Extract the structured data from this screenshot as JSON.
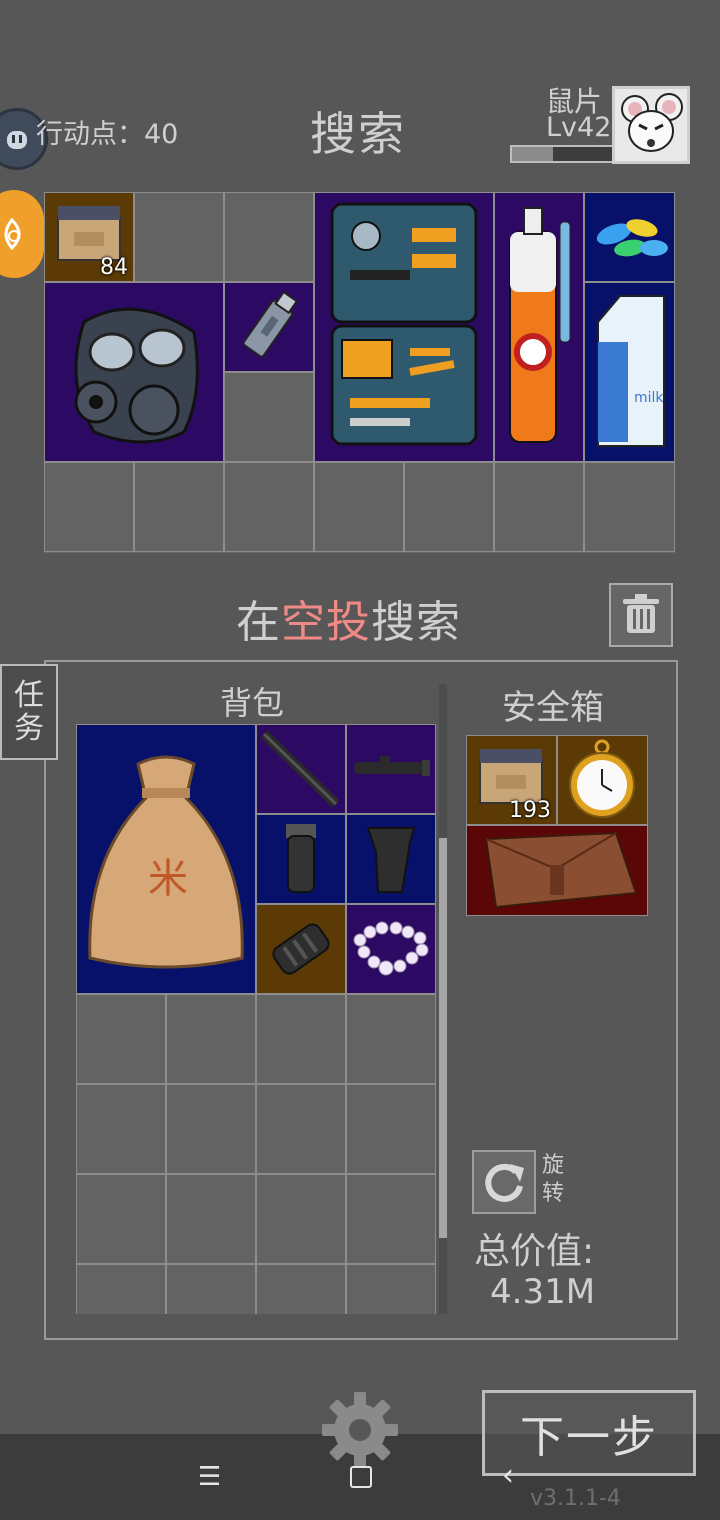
{
  "header": {
    "action_points": "行动点：40",
    "title": "搜索",
    "player_name": "鼠片",
    "player_level": "Lv42",
    "xp_fraction": 0.4
  },
  "search_grid": {
    "items": [
      {
        "name": "cardboard-box",
        "count": "84"
      },
      {
        "name": "gas-mask"
      },
      {
        "name": "usb-drive"
      },
      {
        "name": "toolbox"
      },
      {
        "name": "spray-can"
      },
      {
        "name": "pills"
      },
      {
        "name": "milk-carton"
      }
    ]
  },
  "airdrop": {
    "prefix": "在",
    "highlight": "空投",
    "suffix": "搜索"
  },
  "side": {
    "task_line1": "任",
    "task_line2": "务"
  },
  "backpack": {
    "label": "背包",
    "items": [
      {
        "name": "rice-sack"
      },
      {
        "name": "rifle-handguard"
      },
      {
        "name": "rifle-scope"
      },
      {
        "name": "foregrip"
      },
      {
        "name": "pistol-grip"
      },
      {
        "name": "muzzle-brake"
      },
      {
        "name": "pearl-necklace"
      }
    ]
  },
  "safebox": {
    "label": "安全箱",
    "items": [
      {
        "name": "cardboard-box",
        "count": "193"
      },
      {
        "name": "pocket-watch"
      },
      {
        "name": "leather-pouch"
      }
    ]
  },
  "controls": {
    "rotate_line1": "旋",
    "rotate_line2": "转",
    "total_label": "总价值:",
    "total_value": "4.31M",
    "next_button": "下一步",
    "version": "v3.1.1-4"
  },
  "navbar": {
    "menu_glyph": "☰",
    "back_glyph": "‹"
  }
}
